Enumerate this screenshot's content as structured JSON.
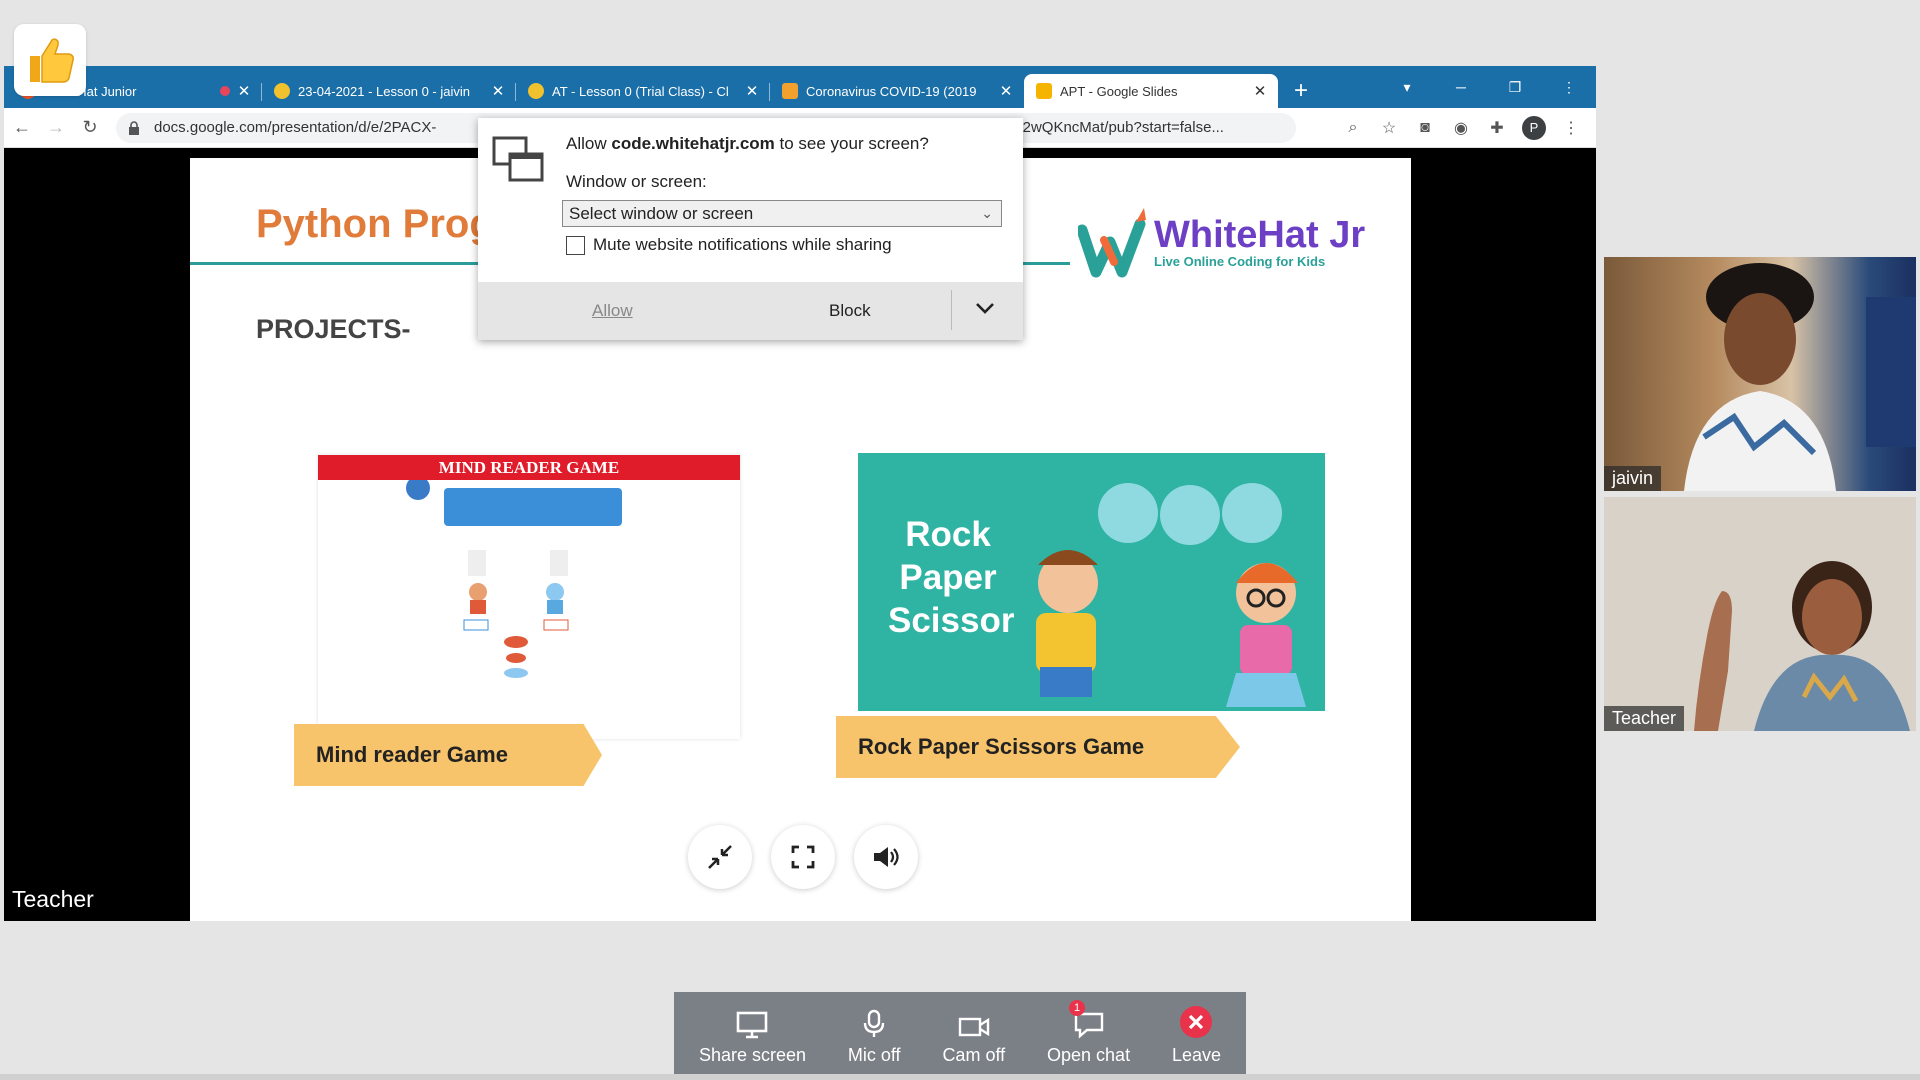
{
  "browser": {
    "tabs": [
      {
        "title": "WhiteHat Junior",
        "active": false,
        "recording": true
      },
      {
        "title": "23-04-2021 - Lesson 0 - jaivin",
        "active": false,
        "recording": false
      },
      {
        "title": "AT - Lesson 0 (Trial Class) - Cl",
        "active": false,
        "recording": false
      },
      {
        "title": "Coronavirus COVID-19 (2019",
        "active": false,
        "recording": false
      },
      {
        "title": "APT - Google Slides",
        "active": true,
        "recording": false
      }
    ],
    "new_tab": "+",
    "url_left": "docs.google.com/presentation/d/e/2PACX-",
    "url_right": "9nS1e6jT2wQKncMat/pub?start=false...",
    "profile_initial": "P"
  },
  "permission_dialog": {
    "question_prefix": "Allow ",
    "domain": "code.whitehatjr.com",
    "question_suffix": " to see your screen?",
    "window_label": "Window or screen:",
    "select_value": "Select window or screen",
    "mute_label": "Mute website notifications while sharing",
    "allow_label": "Allow",
    "block_label": "Block"
  },
  "slide": {
    "title": "Python Prog",
    "projects_heading": "PROJECTS-",
    "logo_name": "WhiteHat Jr",
    "logo_tagline": "Live Online Coding for Kids",
    "mind_reader_header": "MIND READER GAME",
    "mind_reader_label": "Mind reader Game",
    "rps_title_lines": [
      "Rock",
      "Paper",
      "Scissor"
    ],
    "rps_label": "Rock Paper Scissors Game"
  },
  "presenter_label": "Teacher",
  "participants": [
    {
      "name": "jaivin"
    },
    {
      "name": "Teacher"
    }
  ],
  "controls": {
    "share_screen": "Share screen",
    "mic": "Mic off",
    "cam": "Cam off",
    "chat": "Open chat",
    "chat_badge": "1",
    "leave": "Leave"
  },
  "colors": {
    "tabstrip": "#1b6fa8",
    "slide_title": "#e07b39",
    "rps_bg": "#2fb3a3",
    "banner": "#f7c46c",
    "leave": "#e8334a"
  }
}
